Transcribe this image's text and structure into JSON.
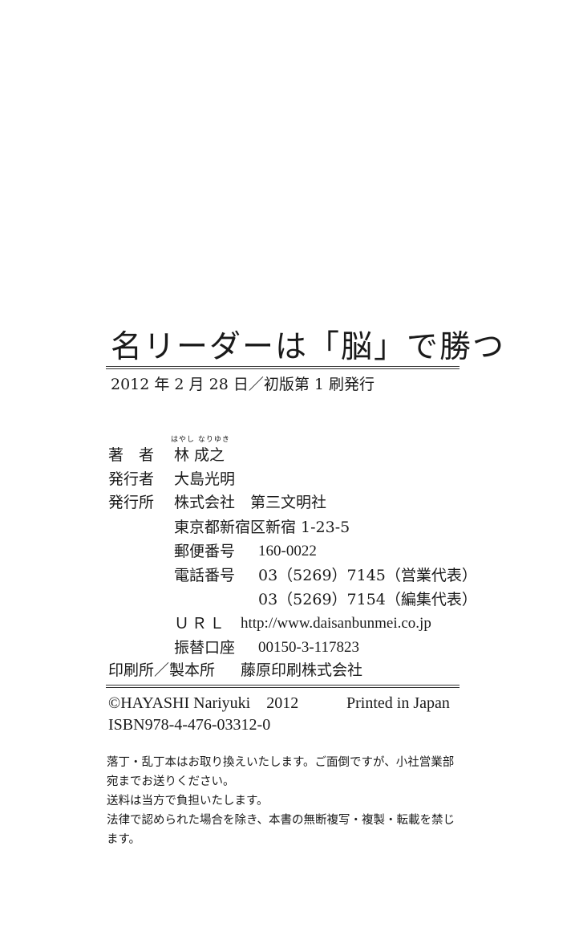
{
  "title": "名リーダーは「脳」で勝つ",
  "publication": "2012 年 2 月 28 日／初版第 1 刷発行",
  "credits": {
    "author_label": "著　者",
    "author_furigana": "はやし なりゆき",
    "author_name": "林 成之",
    "publisher_person_label": "発行者",
    "publisher_person": "大島光明",
    "publisher_label": "発行所",
    "publisher_name": "株式会社　第三文明社",
    "address": "東京都新宿区新宿 1-23-5",
    "postal_label": "郵便番号",
    "postal_code": "160-0022",
    "phone_label": "電話番号",
    "phone_sales": "03（5269）7145（営業代表）",
    "phone_editorial": "03（5269）7154（編集代表）",
    "url_label": "ＵＲＬ",
    "url": "http://www.daisanbunmei.co.jp",
    "transfer_label": "振替口座",
    "transfer_account": "00150-3-117823",
    "printer_label": "印刷所／製本所",
    "printer_name": "藤原印刷株式会社"
  },
  "copyright": {
    "notice": "©HAYASHI Nariyuki　2012",
    "printed_in": "Printed in Japan",
    "isbn": "ISBN978-4-476-03312-0"
  },
  "notes": [
    "落丁・乱丁本はお取り換えいたします。ご面倒ですが、小社営業部宛までお送りください。",
    "送料は当方で負担いたします。",
    "法律で認められた場合を除き、本書の無断複写・複製・転載を禁じます。"
  ]
}
